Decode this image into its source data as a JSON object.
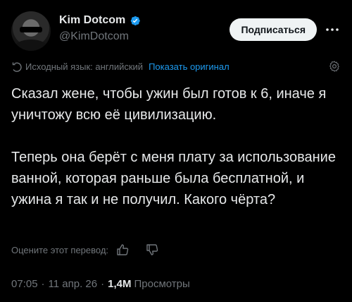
{
  "author": {
    "display_name": "Kim Dotcom",
    "handle": "@KimDotcom",
    "verified": true
  },
  "header": {
    "follow_label": "Подписаться"
  },
  "translation": {
    "source_label": "Исходный язык: английский",
    "show_original_label": "Показать оригинал"
  },
  "tweet": {
    "paragraphs": [
      "Сказал жене, чтобы ужин был готов к 6, иначе я уничтожу всю её цивилизацию.",
      "Теперь она берёт с меня плату за использование ванной, которая раньше была бесплатной, и ужина я так и не получил. Какого чёрта?"
    ]
  },
  "rating": {
    "label": "Оцените этот перевод:"
  },
  "meta": {
    "time": "07:05",
    "date": "11 апр. 26",
    "views_count": "1,4M",
    "views_label": "Просмотры"
  },
  "colors": {
    "background": "#000000",
    "text": "#e7e9ea",
    "muted": "#71767b",
    "accent": "#1d9bf0",
    "button_bg": "#eff3f4"
  },
  "icons": {
    "verified": "verified-badge-icon",
    "more": "more-options-icon",
    "translate": "translate-icon",
    "settings": "gear-icon",
    "thumbs_up": "thumbs-up-icon",
    "thumbs_down": "thumbs-down-icon"
  }
}
